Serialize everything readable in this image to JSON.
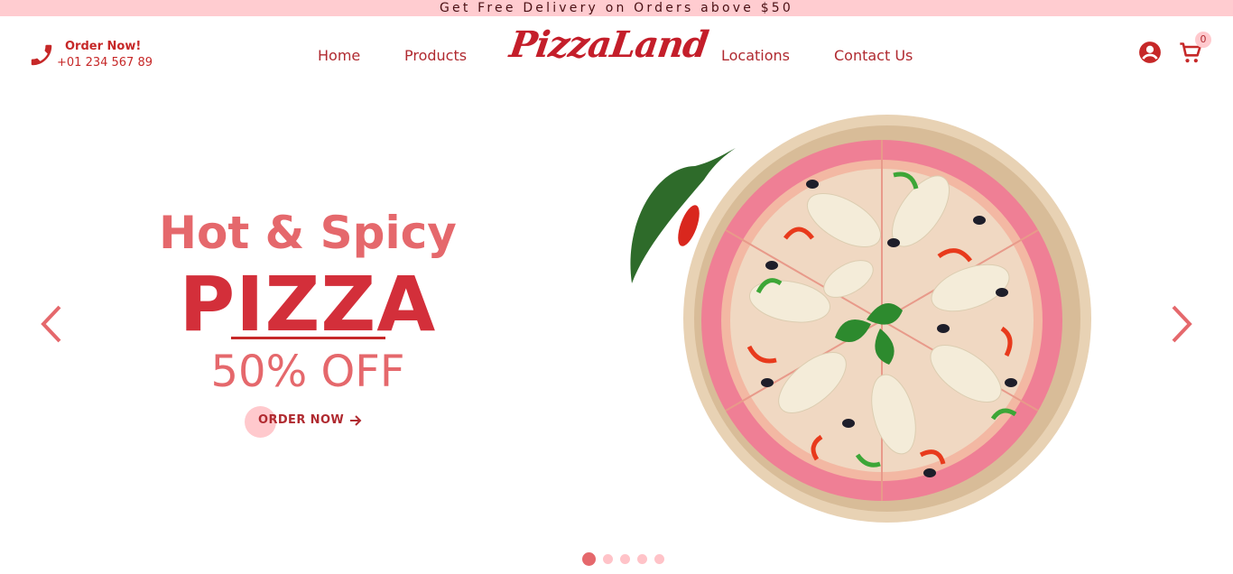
{
  "promo": {
    "text": "Get Free Delivery on Orders above $50"
  },
  "header": {
    "order_title": "Order Now!",
    "order_phone": "+01 234 567 89",
    "logo": "PizzaLand",
    "nav": [
      "Home",
      "Products",
      "Locations",
      "Contact Us"
    ],
    "cart_count": "0"
  },
  "hero": {
    "headline_small": "Hot & Spicy",
    "headline_big": "PIZZA",
    "headline_off": "50% OFF",
    "cta": "ORDER NOW"
  },
  "slider": {
    "active_index": 0,
    "count": 5
  },
  "colors": {
    "primary": "#d32f3a",
    "light": "#e5686c",
    "pink": "#ffccd0"
  },
  "icons": [
    "phone-icon",
    "user-icon",
    "cart-icon",
    "chevron-left-icon",
    "chevron-right-icon",
    "arrow-right-icon"
  ]
}
